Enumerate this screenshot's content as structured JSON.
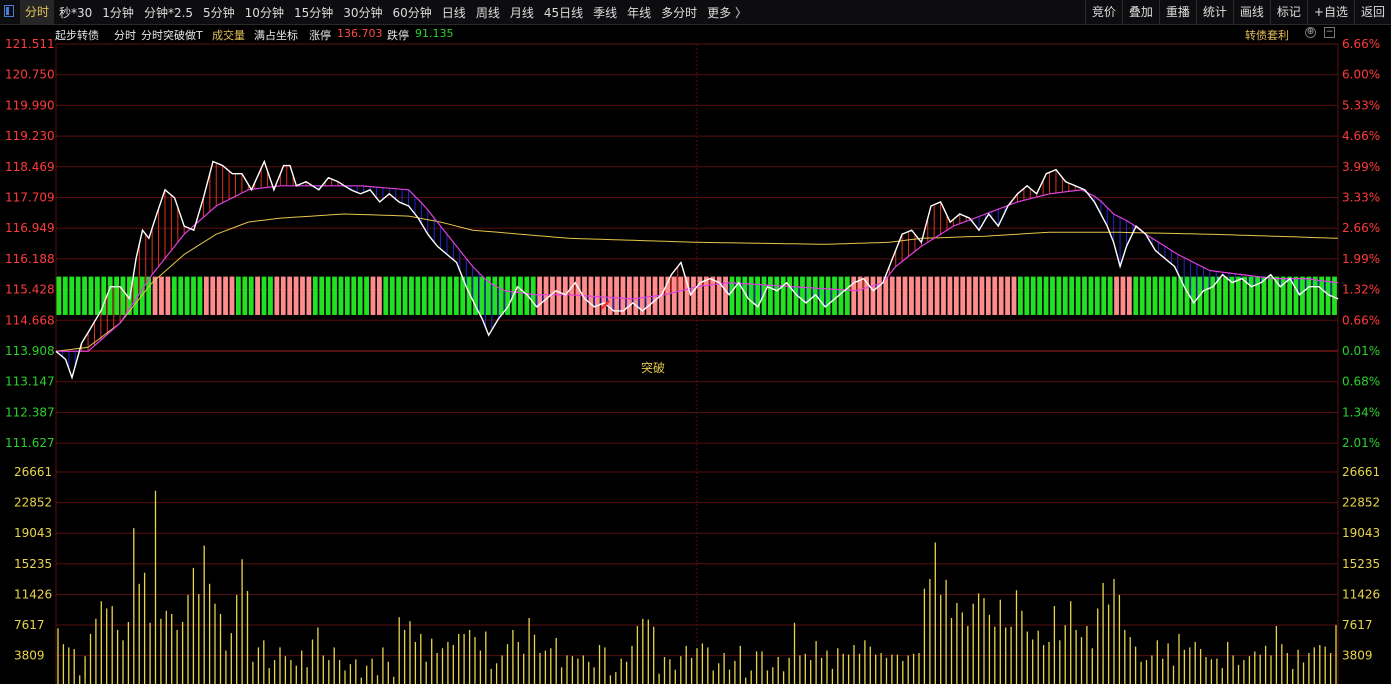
{
  "toolbar": {
    "tabs": [
      "分时",
      "秒*30",
      "1分钟",
      "分钟*2.5",
      "5分钟",
      "10分钟",
      "15分钟",
      "30分钟",
      "60分钟",
      "日线",
      "周线",
      "月线",
      "45日线",
      "季线",
      "年线",
      "多分时",
      "更多 〉"
    ],
    "active_tab": "分时",
    "right_buttons": [
      "竞价",
      "叠加",
      "重播",
      "统计",
      "画线",
      "标记",
      "+自选",
      "返回"
    ]
  },
  "infobar": {
    "security_name": "起步转债",
    "mode": "分时",
    "indicator": "分时突破做T",
    "volume_label": "成交量",
    "axis_mode": "满占坐标",
    "limit_up_label": "涨停",
    "limit_up_value": "136.703",
    "limit_down_label": "跌停",
    "limit_down_value": "91.135",
    "arbitrage_label": "转债套利"
  },
  "annotation": "突破",
  "colors": {
    "up": "#ff3b3b",
    "down": "#2bd12b",
    "flat": "#cccccc",
    "price_line": "#ffffff",
    "avg_line": "#e6c64a",
    "ma_line": "#e040e0",
    "volume": "#e8d44a",
    "grid": "#5a0f0f"
  },
  "chart_data": {
    "type": "line",
    "y_left_ticks": [
      "121.511",
      "120.750",
      "119.990",
      "119.230",
      "118.469",
      "117.709",
      "116.949",
      "116.188",
      "115.428",
      "114.668",
      "113.908",
      "113.147",
      "112.387",
      "111.627"
    ],
    "y_right_ticks": [
      "6.66%",
      "6.00%",
      "5.33%",
      "4.66%",
      "3.99%",
      "3.33%",
      "2.66%",
      "1.99%",
      "1.32%",
      "0.66%",
      "0.01%",
      "0.68%",
      "1.34%",
      "2.01%"
    ],
    "ylim": [
      111.627,
      121.511
    ],
    "prev_close": 113.908,
    "volume_ticks": [
      "26661",
      "22852",
      "19043",
      "15235",
      "11426",
      "7617",
      "3809"
    ],
    "volume_ylim": [
      0,
      30470
    ],
    "price_keypoints": [
      [
        0,
        113.9
      ],
      [
        3,
        113.7
      ],
      [
        5,
        113.25
      ],
      [
        8,
        114.1
      ],
      [
        11,
        114.5
      ],
      [
        14,
        114.9
      ],
      [
        17,
        115.5
      ],
      [
        20,
        115.5
      ],
      [
        23,
        115.2
      ],
      [
        25,
        116.2
      ],
      [
        27,
        116.9
      ],
      [
        29,
        116.7
      ],
      [
        31,
        117.2
      ],
      [
        34,
        117.9
      ],
      [
        37,
        117.7
      ],
      [
        40,
        117.0
      ],
      [
        43,
        116.9
      ],
      [
        46,
        117.7
      ],
      [
        49,
        118.6
      ],
      [
        52,
        118.5
      ],
      [
        55,
        118.3
      ],
      [
        58,
        118.3
      ],
      [
        61,
        117.9
      ],
      [
        65,
        118.6
      ],
      [
        68,
        117.9
      ],
      [
        71,
        118.5
      ],
      [
        73,
        118.5
      ],
      [
        75,
        118.0
      ],
      [
        78,
        118.1
      ],
      [
        82,
        117.9
      ],
      [
        85,
        118.2
      ],
      [
        88,
        118.1
      ],
      [
        92,
        117.9
      ],
      [
        95,
        117.8
      ],
      [
        98,
        117.9
      ],
      [
        101,
        117.6
      ],
      [
        104,
        117.8
      ],
      [
        107,
        117.6
      ],
      [
        110,
        117.5
      ],
      [
        113,
        117.2
      ],
      [
        116,
        116.8
      ],
      [
        119,
        116.5
      ],
      [
        122,
        116.3
      ],
      [
        125,
        116.1
      ],
      [
        128,
        115.5
      ],
      [
        131,
        115.0
      ],
      [
        133,
        114.7
      ],
      [
        135,
        114.3
      ],
      [
        138,
        114.7
      ],
      [
        141,
        115.0
      ],
      [
        144,
        115.5
      ],
      [
        147,
        115.3
      ],
      [
        150,
        115.0
      ],
      [
        153,
        115.2
      ],
      [
        156,
        115.4
      ],
      [
        159,
        115.3
      ],
      [
        162,
        115.6
      ],
      [
        165,
        115.2
      ],
      [
        168,
        115.0
      ],
      [
        171,
        115.1
      ],
      [
        174,
        114.9
      ],
      [
        177,
        114.9
      ],
      [
        180,
        115.1
      ],
      [
        183,
        114.9
      ],
      [
        186,
        115.1
      ],
      [
        189,
        115.3
      ],
      [
        192,
        115.8
      ],
      [
        195,
        116.1
      ],
      [
        198,
        115.3
      ],
      [
        201,
        115.6
      ],
      [
        204,
        115.7
      ],
      [
        207,
        115.6
      ],
      [
        210,
        115.3
      ],
      [
        213,
        115.6
      ],
      [
        216,
        115.2
      ],
      [
        219,
        115.0
      ],
      [
        222,
        115.5
      ],
      [
        225,
        115.4
      ],
      [
        228,
        115.6
      ],
      [
        231,
        115.3
      ],
      [
        234,
        115.1
      ],
      [
        237,
        115.3
      ],
      [
        240,
        115.0
      ],
      [
        243,
        115.2
      ],
      [
        246,
        115.4
      ],
      [
        249,
        115.6
      ],
      [
        252,
        115.7
      ],
      [
        255,
        115.4
      ],
      [
        258,
        115.6
      ],
      [
        261,
        116.2
      ],
      [
        264,
        116.8
      ],
      [
        267,
        116.9
      ],
      [
        270,
        116.6
      ],
      [
        273,
        117.5
      ],
      [
        276,
        117.6
      ],
      [
        279,
        117.1
      ],
      [
        282,
        117.3
      ],
      [
        285,
        117.2
      ],
      [
        288,
        116.9
      ],
      [
        291,
        117.3
      ],
      [
        294,
        117.0
      ],
      [
        297,
        117.5
      ],
      [
        300,
        117.8
      ],
      [
        303,
        118.0
      ],
      [
        306,
        117.8
      ],
      [
        309,
        118.3
      ],
      [
        312,
        118.4
      ],
      [
        315,
        118.1
      ],
      [
        318,
        118.0
      ],
      [
        321,
        117.9
      ],
      [
        324,
        117.6
      ],
      [
        326,
        117.3
      ],
      [
        328,
        117.0
      ],
      [
        330,
        116.6
      ],
      [
        332,
        116.0
      ],
      [
        334,
        116.5
      ],
      [
        337,
        117.0
      ],
      [
        340,
        116.8
      ],
      [
        343,
        116.4
      ],
      [
        346,
        116.2
      ],
      [
        349,
        116.0
      ],
      [
        352,
        115.5
      ],
      [
        355,
        115.1
      ],
      [
        358,
        115.4
      ],
      [
        361,
        115.5
      ],
      [
        364,
        115.8
      ],
      [
        367,
        115.6
      ],
      [
        370,
        115.7
      ],
      [
        373,
        115.5
      ],
      [
        376,
        115.6
      ],
      [
        379,
        115.8
      ],
      [
        382,
        115.5
      ],
      [
        385,
        115.7
      ],
      [
        388,
        115.3
      ],
      [
        391,
        115.5
      ],
      [
        394,
        115.5
      ],
      [
        397,
        115.3
      ],
      [
        400,
        115.2
      ]
    ],
    "avg_keypoints": [
      [
        0,
        113.9
      ],
      [
        10,
        114.0
      ],
      [
        20,
        114.6
      ],
      [
        30,
        115.6
      ],
      [
        40,
        116.3
      ],
      [
        50,
        116.8
      ],
      [
        60,
        117.1
      ],
      [
        70,
        117.2
      ],
      [
        90,
        117.3
      ],
      [
        110,
        117.25
      ],
      [
        120,
        117.1
      ],
      [
        130,
        116.9
      ],
      [
        160,
        116.7
      ],
      [
        200,
        116.6
      ],
      [
        240,
        116.55
      ],
      [
        260,
        116.6
      ],
      [
        270,
        116.7
      ],
      [
        290,
        116.75
      ],
      [
        310,
        116.85
      ],
      [
        330,
        116.85
      ],
      [
        360,
        116.8
      ],
      [
        400,
        116.7
      ]
    ],
    "ma_keypoints": [
      [
        0,
        113.9
      ],
      [
        10,
        113.9
      ],
      [
        20,
        114.6
      ],
      [
        30,
        115.8
      ],
      [
        40,
        116.8
      ],
      [
        50,
        117.5
      ],
      [
        60,
        117.9
      ],
      [
        70,
        118.0
      ],
      [
        80,
        118.0
      ],
      [
        95,
        118.0
      ],
      [
        110,
        117.9
      ],
      [
        115,
        117.5
      ],
      [
        120,
        117.0
      ],
      [
        125,
        116.5
      ],
      [
        130,
        116.0
      ],
      [
        135,
        115.6
      ],
      [
        140,
        115.4
      ],
      [
        150,
        115.3
      ],
      [
        160,
        115.3
      ],
      [
        180,
        115.2
      ],
      [
        190,
        115.3
      ],
      [
        200,
        115.5
      ],
      [
        210,
        115.6
      ],
      [
        230,
        115.5
      ],
      [
        250,
        115.4
      ],
      [
        258,
        115.6
      ],
      [
        262,
        116.0
      ],
      [
        270,
        116.5
      ],
      [
        280,
        117.0
      ],
      [
        290,
        117.3
      ],
      [
        300,
        117.6
      ],
      [
        310,
        117.8
      ],
      [
        320,
        117.9
      ],
      [
        325,
        117.7
      ],
      [
        330,
        117.3
      ],
      [
        335,
        117.1
      ],
      [
        340,
        116.8
      ],
      [
        350,
        116.3
      ],
      [
        360,
        115.9
      ],
      [
        370,
        115.8
      ],
      [
        380,
        115.7
      ],
      [
        390,
        115.7
      ],
      [
        400,
        115.6
      ]
    ],
    "signal_regions": [
      [
        0,
        14,
        "down"
      ],
      [
        14,
        30,
        "down"
      ],
      [
        30,
        36,
        "up"
      ],
      [
        36,
        45,
        "down"
      ],
      [
        45,
        55,
        "up"
      ],
      [
        55,
        61,
        "down"
      ],
      [
        61,
        63,
        "up"
      ],
      [
        63,
        68,
        "down"
      ],
      [
        68,
        80,
        "up"
      ],
      [
        80,
        97,
        "down"
      ],
      [
        97,
        102,
        "up"
      ],
      [
        102,
        115,
        "down"
      ],
      [
        115,
        150,
        "down"
      ],
      [
        150,
        187,
        "up"
      ],
      [
        187,
        209,
        "up"
      ],
      [
        209,
        248,
        "down"
      ],
      [
        248,
        300,
        "up"
      ],
      [
        300,
        330,
        "down"
      ],
      [
        330,
        336,
        "up"
      ],
      [
        336,
        399,
        "down"
      ]
    ],
    "signal_region_colors": {
      "up": "#ff8c8c",
      "down": "#22e022"
    },
    "volume_values": [
      7000,
      5000,
      4600,
      4400,
      1100,
      3500,
      6300,
      8200,
      10400,
      9500,
      9800,
      6800,
      5500,
      7800,
      19600,
      12600,
      14000,
      7700,
      24300,
      8200,
      9200,
      8800,
      6800,
      7800,
      11200,
      14600,
      11300,
      17400,
      12600,
      10100,
      8800,
      4200,
      6400,
      11200,
      15700,
      11700,
      2800,
      4600,
      5500,
      2000,
      3000,
      4600,
      3500,
      3000,
      2300,
      4200,
      2100,
      5600,
      7100,
      3600,
      3000,
      4600,
      3000,
      1700,
      2500,
      3100,
      800,
      2300,
      3200,
      1100,
      4600,
      2800,
      900,
      8400,
      6800,
      7900,
      5300,
      6300,
      2800,
      5700,
      3900,
      4500,
      5300,
      4900,
      6300,
      6300,
      6800,
      5900,
      4200,
      6600,
      1900,
      2600,
      3600,
      5000,
      6800,
      5300,
      3800,
      8300,
      6200,
      3900,
      4200,
      4500,
      5800,
      2100,
      3600,
      3500,
      3200,
      3600,
      2800,
      2100,
      4900,
      4600,
      1100,
      1500,
      3200,
      2800,
      4800,
      7300,
      8200,
      8100,
      7200,
      1300,
      3400,
      3100,
      1800,
      3500,
      4800,
      3300,
      4500,
      5100,
      4600,
      1700,
      2600,
      3900,
      1800,
      2900,
      4800,
      800,
      1700,
      4100,
      4100,
      1700,
      2100,
      3400,
      1600,
      3300,
      7700,
      3600,
      3800,
      3000,
      5400,
      3300,
      4200,
      1900,
      4500,
      3800,
      3700,
      4900,
      3800,
      5500,
      4700,
      3700,
      3900,
      3300,
      3700,
      3700,
      2900,
      3600,
      3800,
      3900,
      12000,
      13200,
      17800,
      11200,
      13100,
      8300,
      10200,
      9000,
      7300,
      10100,
      11400,
      10800,
      8700,
      7200,
      10600,
      7100,
      7200,
      11800,
      9200,
      6600,
      5600,
      6700,
      4900,
      5300,
      9800,
      5500,
      7400,
      10400,
      6800,
      5900,
      7300,
      4500,
      9500,
      12700,
      10000,
      13200,
      11200,
      6800,
      5900,
      4700,
      2800,
      3000,
      3600,
      5500,
      3200,
      5100,
      2300,
      6300,
      4300,
      4600,
      5300,
      4400,
      3400,
      3100,
      3200,
      2000,
      5300,
      3600,
      2400,
      3000,
      3500,
      4100,
      3700,
      4800,
      3600,
      7300,
      5000,
      3900,
      1900,
      4300,
      2700,
      3900,
      4600,
      4900,
      4700,
      3900,
      7400
    ],
    "volume_colors": [
      "#e8d44a"
    ]
  }
}
